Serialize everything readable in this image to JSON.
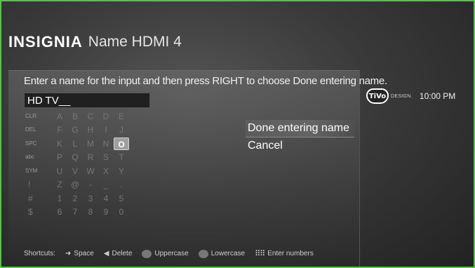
{
  "header": {
    "brand": "INSIGNIA",
    "title": "Name HDMI 4"
  },
  "instruction": "Enter a name for the input and then press RIGHT to choose Done entering name.",
  "name_input": {
    "value": "HD TV__"
  },
  "keyboard": {
    "rows": [
      {
        "func": "CLR",
        "keys": [
          "A",
          "B",
          "C",
          "D",
          "E"
        ]
      },
      {
        "func": "DEL",
        "keys": [
          "F",
          "G",
          "H",
          "I",
          "J"
        ]
      },
      {
        "func": "SPC",
        "keys": [
          "K",
          "L",
          "M",
          "N",
          "O"
        ]
      },
      {
        "func": "abc",
        "keys": [
          "P",
          "Q",
          "R",
          "S",
          "T"
        ]
      },
      {
        "func": "SYM",
        "keys": [
          "U",
          "V",
          "W",
          "X",
          "Y"
        ]
      },
      {
        "func": "!",
        "keys": [
          "Z",
          "@",
          "-",
          "_",
          "."
        ]
      },
      {
        "func": "#",
        "keys": [
          "1",
          "2",
          "3",
          "4",
          "5"
        ]
      },
      {
        "func": "$",
        "keys": [
          "6",
          "7",
          "8",
          "9",
          "0"
        ]
      }
    ],
    "selected_key": "O"
  },
  "menu": {
    "items": [
      "Done entering name",
      "Cancel"
    ],
    "active_index": 0
  },
  "shortcuts": {
    "label": "Shortcuts:",
    "items": [
      {
        "icon": "right-arrow-icon",
        "label": "Space"
      },
      {
        "icon": "left-arrow-icon",
        "label": "Delete"
      },
      {
        "icon": "thumbs-down-icon",
        "label": "Uppercase"
      },
      {
        "icon": "thumbs-up-icon",
        "label": "Lowercase"
      },
      {
        "icon": "keypad-icon",
        "label": "Enter numbers"
      }
    ]
  },
  "status": {
    "logo": "TiVo",
    "logo_suffix": "DESIGN.",
    "time": "10:00 PM"
  },
  "colors": {
    "frame_border": "#58c24a",
    "background": "#3a3a3a",
    "text": "#ffffff"
  }
}
